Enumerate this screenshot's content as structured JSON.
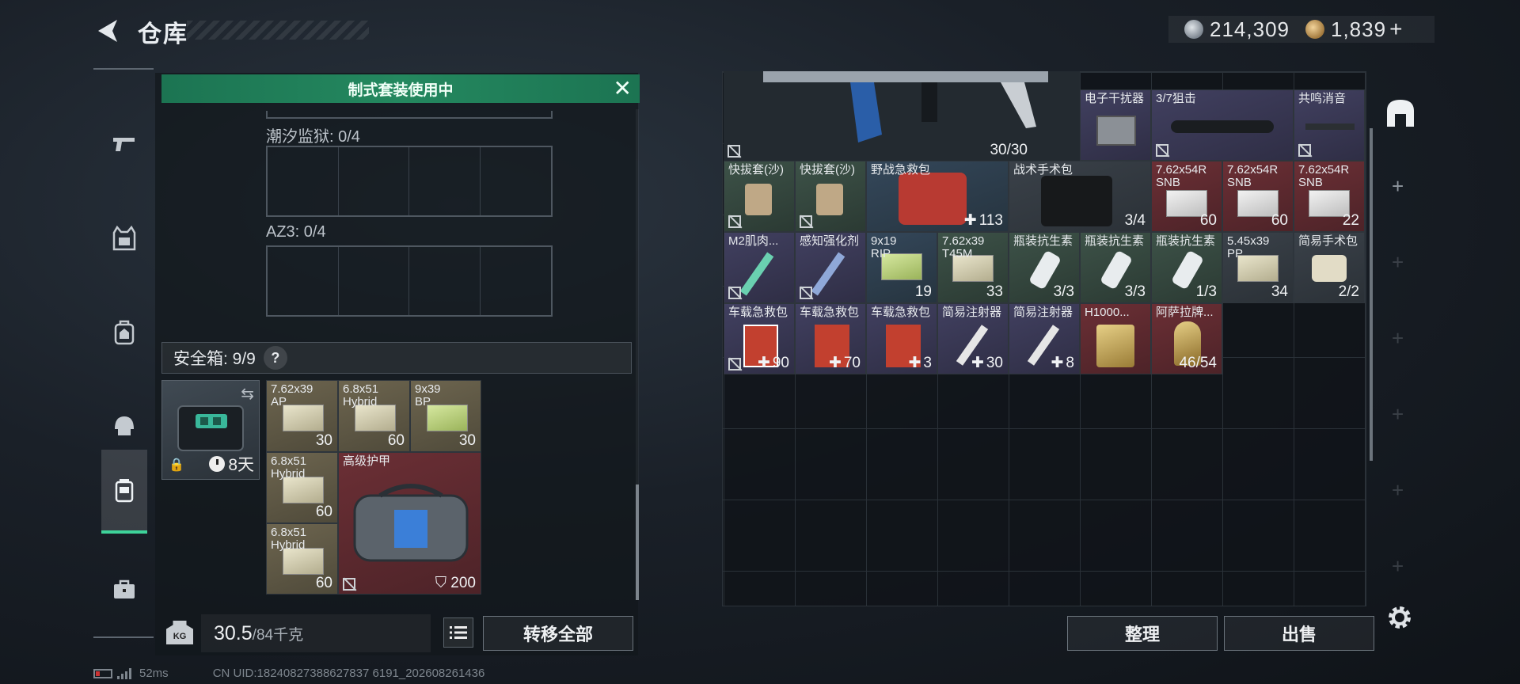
{
  "header": {
    "title": "仓库"
  },
  "currency": {
    "silver": "214,309",
    "gold": "1,839",
    "add": "+"
  },
  "nav": {
    "items": [
      {
        "id": "weapons",
        "icon": "pistol-icon"
      },
      {
        "id": "armor",
        "icon": "vest-icon"
      },
      {
        "id": "backpack",
        "icon": "backpack-icon"
      },
      {
        "id": "rig",
        "icon": "helmet-icon"
      },
      {
        "id": "safebox",
        "icon": "safebox-icon",
        "active": true
      },
      {
        "id": "toolbox",
        "icon": "briefcase-icon"
      }
    ]
  },
  "loadout": {
    "banner": "制式套装使用中",
    "sections": [
      {
        "label": "潮汐监狱: 0/4"
      },
      {
        "label": "AZ3: 0/4"
      }
    ]
  },
  "safebox": {
    "header": "安全箱: 9/9",
    "help": "?",
    "days": "8天",
    "items": [
      {
        "name": "7.62x39\nAP",
        "qty": "30",
        "bg": "tan"
      },
      {
        "name": "6.8x51\nHybrid",
        "qty": "60",
        "bg": "tan"
      },
      {
        "name": "9x39\nBP",
        "qty": "30",
        "bg": "tan"
      },
      {
        "name": "6.8x51\nHybrid",
        "qty": "60",
        "bg": "tan"
      },
      {
        "name": "6.8x51\nHybrid",
        "qty": "60",
        "bg": "tan"
      },
      {
        "name": "高级护甲",
        "qty": "200",
        "bg": "red"
      }
    ]
  },
  "footer": {
    "weight_current": "30.5",
    "weight_max": "/84千克",
    "kg_label": "KG",
    "transfer_all": "转移全部"
  },
  "stash": {
    "weapon_ammo": "30/30",
    "row1": [
      {
        "name": "电子干扰器",
        "qty": ""
      },
      {
        "name": "3/7狙击",
        "qty": ""
      },
      {
        "name": "共鸣消音",
        "qty": ""
      }
    ],
    "row2": [
      {
        "name": "快拔套(沙)",
        "qty": ""
      },
      {
        "name": "快拔套(沙)",
        "qty": ""
      },
      {
        "name": "野战急救包",
        "qty": "113"
      },
      {
        "name": "战术手术包",
        "qty": "3/4"
      },
      {
        "name": "7.62x54R\nSNB",
        "qty": "60"
      },
      {
        "name": "7.62x54R\nSNB",
        "qty": "60"
      },
      {
        "name": "7.62x54R\nSNB",
        "qty": "22"
      }
    ],
    "row3": [
      {
        "name": "M2肌肉...",
        "qty": ""
      },
      {
        "name": "感知强化剂",
        "qty": ""
      },
      {
        "name": "9x19\nRIP",
        "qty": "19"
      },
      {
        "name": "7.62x39\nT45M",
        "qty": "33"
      },
      {
        "name": "瓶装抗生素",
        "qty": "3/3"
      },
      {
        "name": "瓶装抗生素",
        "qty": "3/3"
      },
      {
        "name": "瓶装抗生素",
        "qty": "1/3"
      },
      {
        "name": "5.45x39\nPP",
        "qty": "34"
      },
      {
        "name": "简易手术包",
        "qty": "2/2"
      }
    ],
    "row4": [
      {
        "name": "车载急救包",
        "qty": "90"
      },
      {
        "name": "车载急救包",
        "qty": "70"
      },
      {
        "name": "车载急救包",
        "qty": "3"
      },
      {
        "name": "简易注射器",
        "qty": "30"
      },
      {
        "name": "简易注射器",
        "qty": "8"
      },
      {
        "name": "H1000...",
        "qty": ""
      },
      {
        "name": "阿萨拉牌...",
        "qty": "46/54"
      }
    ],
    "sort": "整理",
    "sell": "出售"
  },
  "status": {
    "ping": "52ms",
    "uid": "CN UID:18240827388627837 6191_202608261436"
  },
  "colors": {
    "accent_green": "#24885f",
    "active_tab": "#3ed39a",
    "red_item": "#6b2f35"
  }
}
